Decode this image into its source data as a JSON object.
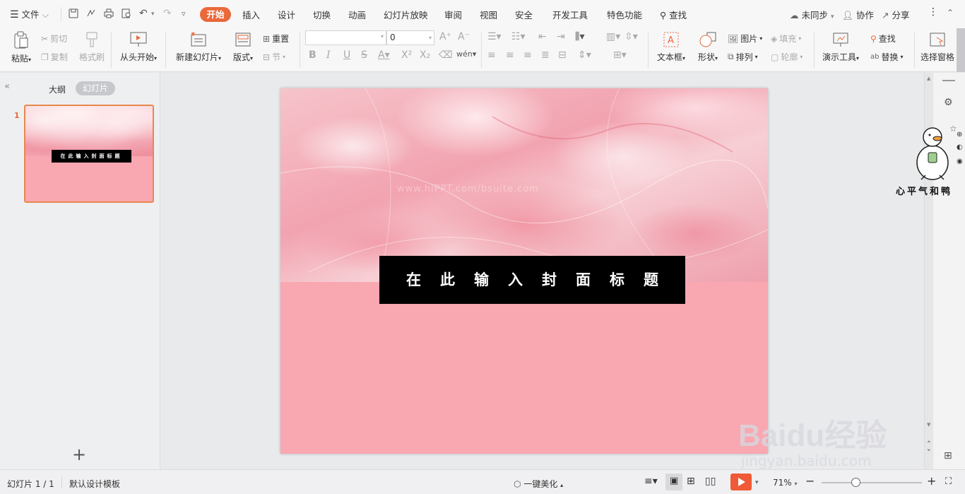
{
  "menubar": {
    "file_label": "文件",
    "tabs": [
      "开始",
      "插入",
      "设计",
      "切换",
      "动画",
      "幻灯片放映",
      "审阅",
      "视图",
      "安全",
      "开发工具",
      "特色功能"
    ],
    "search_label": "查找",
    "sync_label": "未同步",
    "collab_label": "协作",
    "share_label": "分享"
  },
  "ribbon": {
    "paste": "粘贴",
    "cut": "剪切",
    "copy": "复制",
    "format_painter": "格式刷",
    "from_start": "从头开始",
    "new_slide": "新建幻灯片",
    "layout": "版式",
    "reset": "重置",
    "section": "节",
    "font_name": "",
    "font_size": "0",
    "textbox": "文本框",
    "shape": "形状",
    "picture": "图片",
    "arrange": "排列",
    "fill": "填充",
    "outline": "轮廓",
    "present_tools": "演示工具",
    "find": "查找",
    "replace": "替换",
    "select_pane": "选择窗格"
  },
  "leftpane": {
    "outline_tab": "大纲",
    "slides_tab": "幻灯片",
    "slide_number": "1",
    "add_symbol": "+"
  },
  "slide": {
    "title": "在此输入封面标题",
    "faint_text": "www.hiPPT.com/bsuite.com"
  },
  "sticker": {
    "caption": "心平气和鸭"
  },
  "statusbar": {
    "slide_info": "幻灯片 1 / 1",
    "template": "默认设计模板",
    "beautify": "一键美化",
    "zoom": "71%",
    "zoom_level": 0.71
  },
  "watermark": {
    "brand": "Baidu经验",
    "url": "jingyan.baidu.com"
  },
  "colors": {
    "accent": "#e9693a",
    "slide_pink": "#f9a7b0",
    "title_bg": "#000000"
  }
}
